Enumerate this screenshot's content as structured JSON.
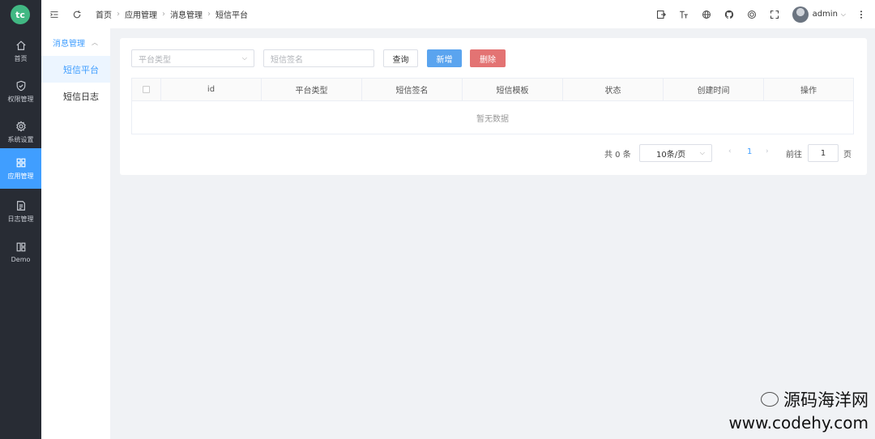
{
  "brand": {
    "logo_text": "tc"
  },
  "sidebar": {
    "items": [
      {
        "label": "首页",
        "icon": "home-icon"
      },
      {
        "label": "权限管理",
        "icon": "shield-icon"
      },
      {
        "label": "系统设置",
        "icon": "gear-icon"
      },
      {
        "label": "应用管理",
        "icon": "grid-icon",
        "active": true
      },
      {
        "label": "日志管理",
        "icon": "log-icon"
      },
      {
        "label": "Demo",
        "icon": "demo-icon"
      }
    ]
  },
  "submenu": {
    "group": "消息管理",
    "items": [
      {
        "label": "短信平台",
        "active": true
      },
      {
        "label": "短信日志"
      }
    ]
  },
  "breadcrumb": [
    "首页",
    "应用管理",
    "消息管理",
    "短信平台"
  ],
  "header": {
    "username": "admin"
  },
  "search": {
    "platform_placeholder": "平台类型",
    "signature_placeholder": "短信签名",
    "query_label": "查询",
    "add_label": "新增",
    "delete_label": "删除"
  },
  "table": {
    "columns": [
      "id",
      "平台类型",
      "短信签名",
      "短信模板",
      "状态",
      "创建时间",
      "操作"
    ],
    "empty_text": "暂无数据"
  },
  "pagination": {
    "total_text": "共 0 条",
    "page_size": "10条/页",
    "current_page": "1",
    "goto_label": "前往",
    "goto_value": "1",
    "page_suffix": "页"
  },
  "watermark": {
    "name": "源码海洋网",
    "url": "www.codehy.com"
  },
  "colors": {
    "sidebar_bg": "#282c34",
    "primary": "#409eff",
    "danger": "#e37373",
    "logo": "#41b883"
  }
}
